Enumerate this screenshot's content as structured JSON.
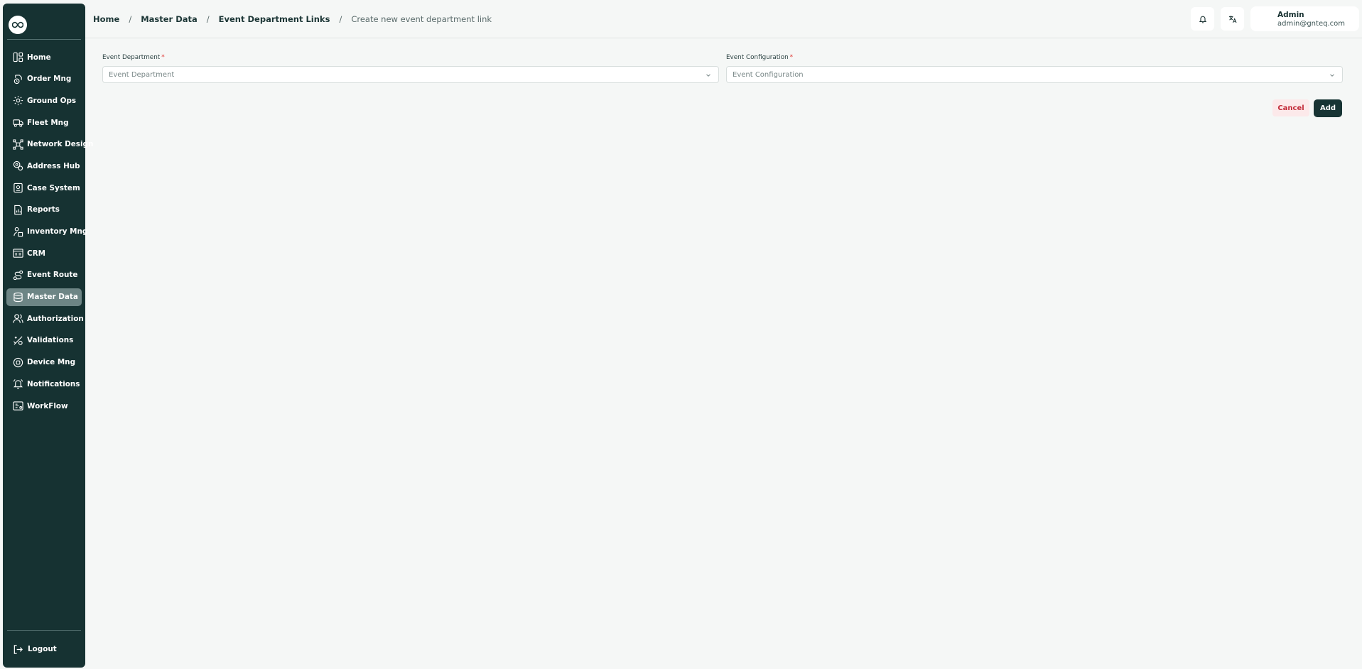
{
  "sidebar": {
    "logo_icon": "infinity-icon",
    "items": [
      {
        "label": "Home",
        "icon": "home-icon"
      },
      {
        "label": "Order Mng",
        "icon": "order-icon"
      },
      {
        "label": "Ground Ops",
        "icon": "ground-ops-icon"
      },
      {
        "label": "Fleet Mng",
        "icon": "truck-icon"
      },
      {
        "label": "Network Design",
        "icon": "network-icon"
      },
      {
        "label": "Address Hub",
        "icon": "address-icon"
      },
      {
        "label": "Case System",
        "icon": "case-icon"
      },
      {
        "label": "Reports",
        "icon": "report-icon"
      },
      {
        "label": "Inventory Mng",
        "icon": "inventory-icon"
      },
      {
        "label": "CRM",
        "icon": "crm-icon"
      },
      {
        "label": "Event Route",
        "icon": "route-icon"
      },
      {
        "label": "Master Data",
        "icon": "database-icon",
        "active": true
      },
      {
        "label": "Authorization",
        "icon": "users-icon"
      },
      {
        "label": "Validations",
        "icon": "validation-icon"
      },
      {
        "label": "Device Mng",
        "icon": "device-icon"
      },
      {
        "label": "Notifications",
        "icon": "bell-icon"
      },
      {
        "label": "WorkFlow",
        "icon": "workflow-icon"
      }
    ],
    "logout_label": "Logout"
  },
  "header": {
    "breadcrumbs": [
      "Home",
      "Master Data",
      "Event Department Links"
    ],
    "current": "Create new event department link",
    "separator": "/",
    "user": {
      "name": "Admin",
      "email": "admin@gnteq.com"
    }
  },
  "form": {
    "event_department": {
      "label": "Event Department",
      "placeholder": "Event Department"
    },
    "event_configuration": {
      "label": "Event Configuration",
      "placeholder": "Event Configuration"
    },
    "required_mark": "*",
    "cancel_label": "Cancel",
    "add_label": "Add"
  },
  "colors": {
    "sidebar_bg": "#163232",
    "active_item": "#6d8585",
    "cancel_text": "#c22a38",
    "add_bg": "#173434"
  }
}
